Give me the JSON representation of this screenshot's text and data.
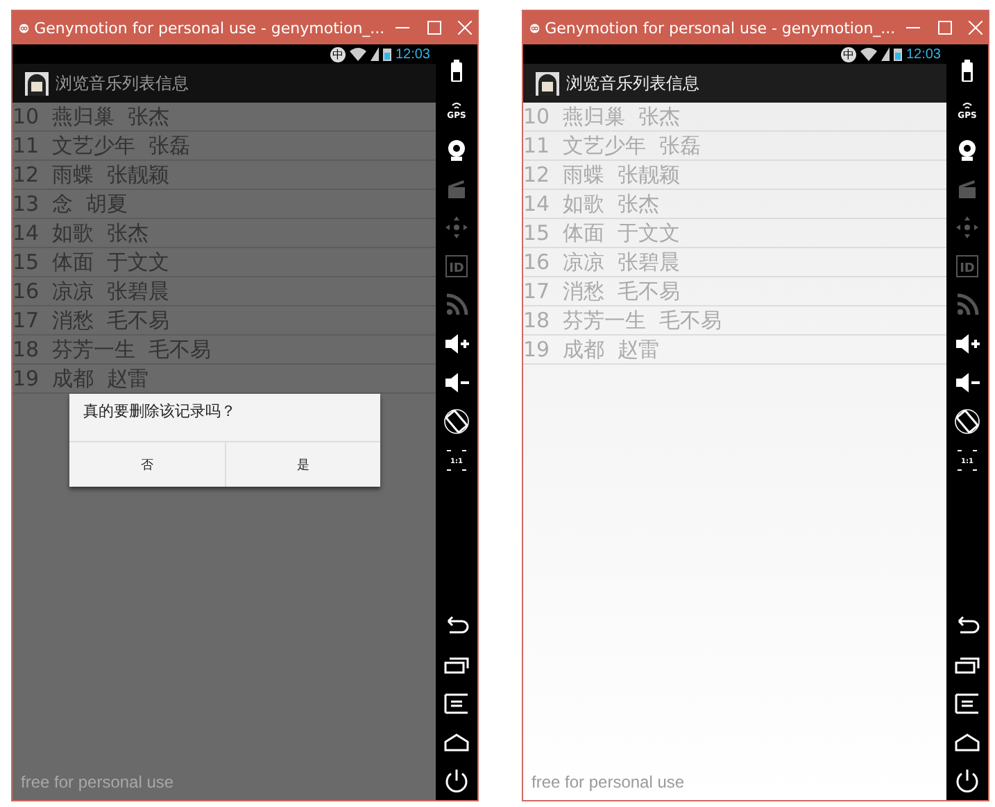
{
  "windows": [
    {
      "title": "Genymotion for personal use - genymotion_...",
      "status": {
        "ime": "中",
        "time": "12:03"
      },
      "app_title": "浏览音乐列表信息",
      "rows": [
        "10  燕归巢  张杰",
        "11  文艺少年  张磊",
        "12  雨蝶  张靓颖",
        "13  念  胡夏",
        "14  如歌  张杰",
        "15  体面  于文文",
        "16  凉凉  张碧晨",
        "17  消愁  毛不易",
        "18  芬芳一生  毛不易",
        "19  成都  赵雷"
      ],
      "dialog": {
        "message": "真的要删除该记录吗？",
        "buttons": [
          "否",
          "是"
        ]
      },
      "overlay_text": "free for personal use",
      "sidebar": [
        {
          "kind": "battery",
          "disabled": false
        },
        {
          "kind": "gps",
          "label": "GPS",
          "disabled": false
        },
        {
          "kind": "webcam",
          "disabled": false
        },
        {
          "kind": "clapper",
          "disabled": true
        },
        {
          "kind": "dpad",
          "disabled": true
        },
        {
          "kind": "id",
          "label": "ID",
          "disabled": true
        },
        {
          "kind": "rss",
          "disabled": true
        },
        {
          "kind": "vol-up",
          "disabled": false
        },
        {
          "kind": "vol-down",
          "disabled": false
        },
        {
          "kind": "rotate",
          "disabled": false
        },
        {
          "kind": "pixel",
          "label": "1:1",
          "disabled": false
        },
        {
          "kind": "back",
          "disabled": false
        },
        {
          "kind": "recent",
          "disabled": false
        },
        {
          "kind": "menu",
          "disabled": false
        },
        {
          "kind": "home",
          "disabled": false
        },
        {
          "kind": "power",
          "disabled": false
        }
      ]
    },
    {
      "title": "Genymotion for personal use - genymotion_...",
      "status": {
        "ime": "中",
        "time": "12:03"
      },
      "app_title": "浏览音乐列表信息",
      "rows": [
        "10  燕归巢  张杰",
        "11  文艺少年  张磊",
        "12  雨蝶  张靓颖",
        "14  如歌  张杰",
        "15  体面  于文文",
        "16  凉凉  张碧晨",
        "17  消愁  毛不易",
        "18  芬芳一生  毛不易",
        "19  成都  赵雷"
      ],
      "overlay_text": "free for personal use",
      "sidebar": [
        {
          "kind": "battery",
          "disabled": false
        },
        {
          "kind": "gps",
          "label": "GPS",
          "disabled": false
        },
        {
          "kind": "webcam",
          "disabled": false
        },
        {
          "kind": "clapper",
          "disabled": true
        },
        {
          "kind": "dpad",
          "disabled": true
        },
        {
          "kind": "id",
          "label": "ID",
          "disabled": true
        },
        {
          "kind": "rss",
          "disabled": true
        },
        {
          "kind": "vol-up",
          "disabled": false
        },
        {
          "kind": "vol-down",
          "disabled": false
        },
        {
          "kind": "rotate",
          "disabled": false
        },
        {
          "kind": "pixel",
          "label": "1:1",
          "disabled": false
        },
        {
          "kind": "back",
          "disabled": false
        },
        {
          "kind": "recent",
          "disabled": false
        },
        {
          "kind": "menu",
          "disabled": false
        },
        {
          "kind": "home",
          "disabled": false
        },
        {
          "kind": "power",
          "disabled": false
        }
      ]
    }
  ]
}
